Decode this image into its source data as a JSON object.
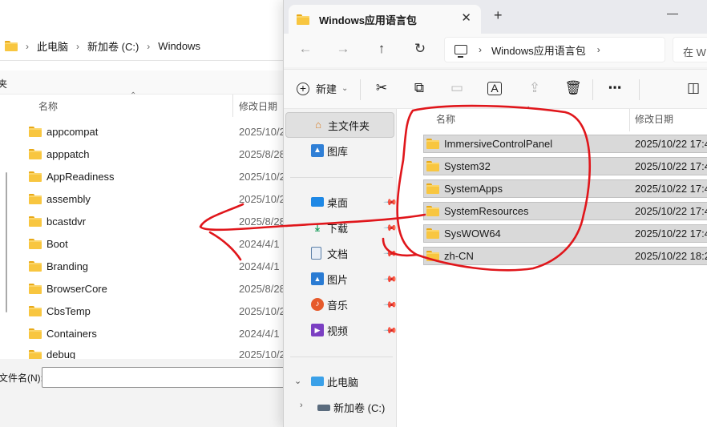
{
  "background_window": {
    "breadcrumb": [
      "此电脑",
      "新加卷 (C:)",
      "Windows"
    ],
    "cmd_partial": "夹",
    "columns": {
      "name": "名称",
      "date": "修改日期"
    },
    "rows": [
      {
        "name": "appcompat",
        "date": "2025/10/2"
      },
      {
        "name": "apppatch",
        "date": "2025/8/28"
      },
      {
        "name": "AppReadiness",
        "date": "2025/10/2"
      },
      {
        "name": "assembly",
        "date": "2025/10/2"
      },
      {
        "name": "bcastdvr",
        "date": "2025/8/28"
      },
      {
        "name": "Boot",
        "date": "2024/4/1"
      },
      {
        "name": "Branding",
        "date": "2024/4/1"
      },
      {
        "name": "BrowserCore",
        "date": "2025/8/28"
      },
      {
        "name": "CbsTemp",
        "date": "2025/10/2"
      },
      {
        "name": "Containers",
        "date": "2024/4/1"
      },
      {
        "name": "debug",
        "date": "2025/10/2"
      }
    ],
    "filename_label": "文件名(N):"
  },
  "foreground_window": {
    "tab_title": "Windows应用语言包",
    "tab_close": "✕",
    "new_tab": "+",
    "minimize": "—",
    "address": {
      "segment": "Windows应用语言包",
      "chevron": "›"
    },
    "search_partial": "在 W",
    "nav_buttons": {
      "back": "←",
      "forward": "→",
      "up": "↑",
      "refresh": "↻"
    },
    "toolbar": {
      "new_label": "新建",
      "icons": [
        "cut-icon",
        "copy-icon",
        "paste-icon",
        "rename-icon",
        "share-icon",
        "delete-icon",
        "more-icon",
        "details-icon"
      ]
    },
    "nav_pane": {
      "home": "主文件夹",
      "gallery": "图库",
      "quick_access": [
        {
          "label": "桌面",
          "icon": "desktop-icon"
        },
        {
          "label": "下载",
          "icon": "download-icon"
        },
        {
          "label": "文档",
          "icon": "documents-icon"
        },
        {
          "label": "图片",
          "icon": "pictures-icon"
        },
        {
          "label": "音乐",
          "icon": "music-icon"
        },
        {
          "label": "视频",
          "icon": "videos-icon"
        }
      ],
      "this_pc": "此电脑",
      "drive": "新加卷 (C:)"
    },
    "columns": {
      "name": "名称",
      "date": "修改日期"
    },
    "files": [
      {
        "name": "ImmersiveControlPanel",
        "date": "2025/10/22 17:4"
      },
      {
        "name": "System32",
        "date": "2025/10/22 17:4"
      },
      {
        "name": "SystemApps",
        "date": "2025/10/22 17:4"
      },
      {
        "name": "SystemResources",
        "date": "2025/10/22 17:4"
      },
      {
        "name": "SysWOW64",
        "date": "2025/10/22 17:4"
      },
      {
        "name": "zh-CN",
        "date": "2025/10/22 18:2"
      }
    ]
  },
  "colors": {
    "annotation_red": "#e0161b",
    "folder_yellow": "#f8c640",
    "selection_gray": "#d9d9d9"
  }
}
